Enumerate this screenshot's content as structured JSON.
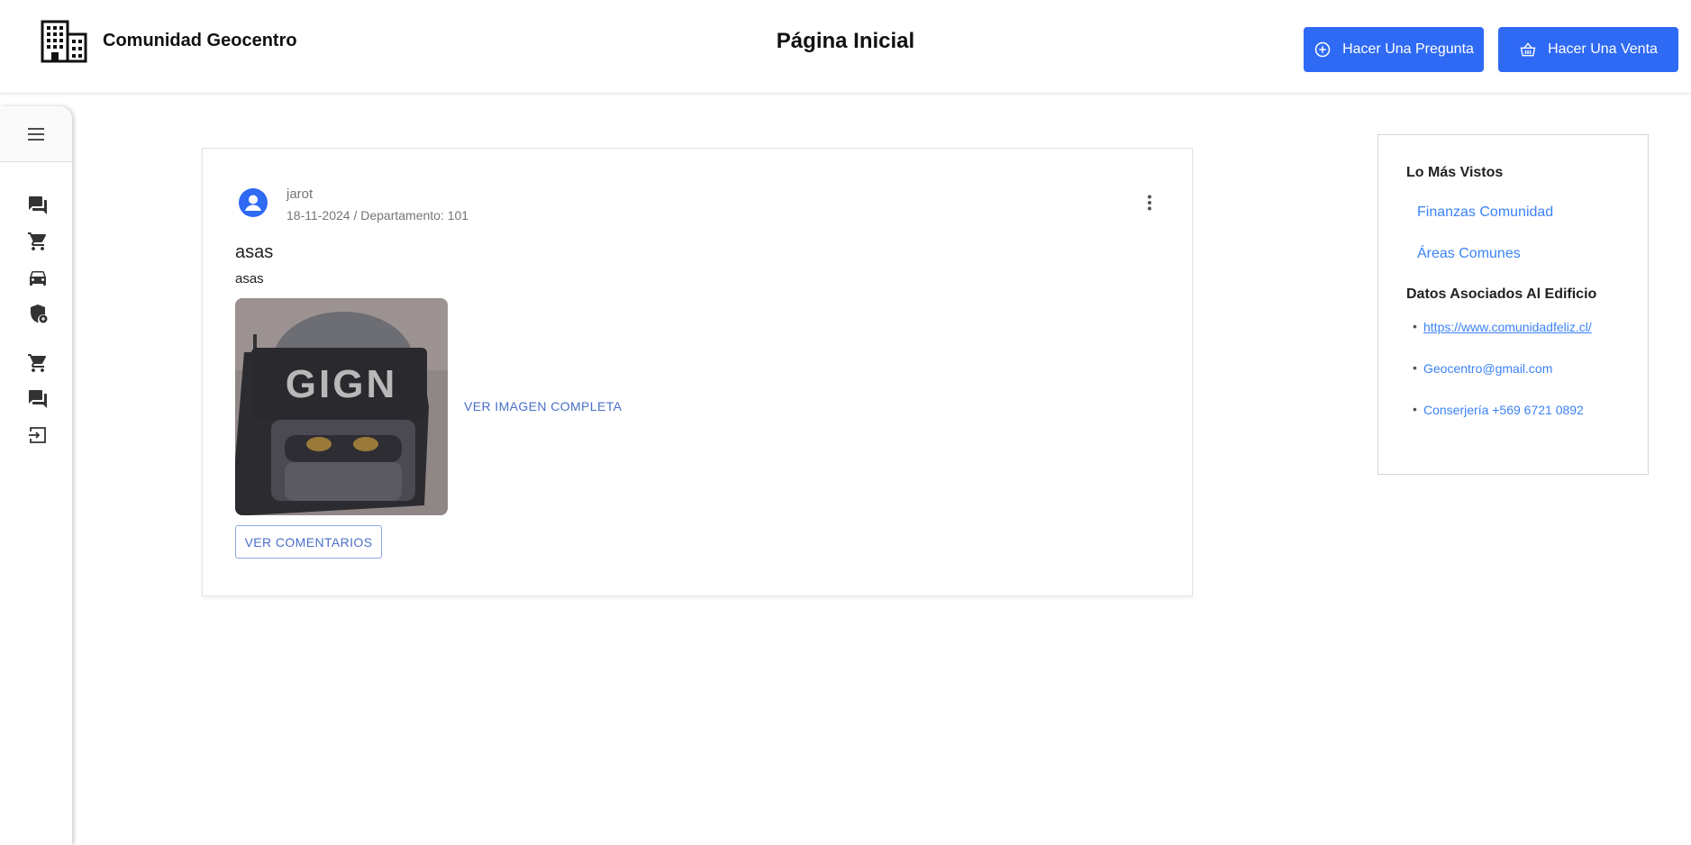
{
  "header": {
    "brand_name": "Comunidad Geocentro",
    "page_title": "Página Inicial",
    "ask_button": "Hacer Una Pregunta",
    "sell_button": "Hacer Una Venta",
    "accent_color": "#2f6af5"
  },
  "sidebar": {
    "icons": [
      "menu-icon",
      "forum-icon",
      "cart-icon",
      "car-icon",
      "shield-icon",
      "cart-icon",
      "forum-icon",
      "logout-icon"
    ]
  },
  "post": {
    "author": "jarot",
    "meta": "18-11-2024 / Departamento: 101",
    "title": "asas",
    "body": "asas",
    "image_text": "GIGN",
    "view_image_link": "VER IMAGEN COMPLETA",
    "comments_button": "VER COMENTARIOS"
  },
  "panel": {
    "most_viewed_title": "Lo Más Vistos",
    "most_viewed": [
      "Finanzas Comunidad",
      "Áreas Comunes"
    ],
    "building_title": "Datos Asociados Al Edificio",
    "building_data": [
      "https://www.comunidadfeliz.cl/",
      "Geocentro@gmail.com",
      "Conserjería +569 6721 0892"
    ],
    "link_color": "#3b82f6"
  }
}
